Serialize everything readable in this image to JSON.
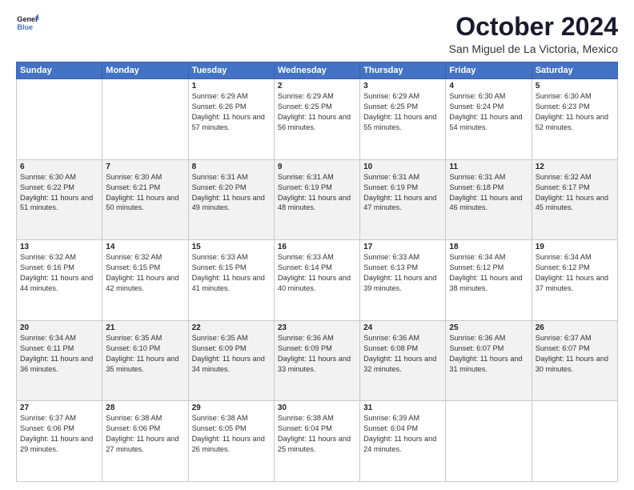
{
  "header": {
    "logo_line1": "General",
    "logo_line2": "Blue",
    "month": "October 2024",
    "location": "San Miguel de La Victoria, Mexico"
  },
  "weekdays": [
    "Sunday",
    "Monday",
    "Tuesday",
    "Wednesday",
    "Thursday",
    "Friday",
    "Saturday"
  ],
  "weeks": [
    [
      {
        "day": "",
        "info": ""
      },
      {
        "day": "",
        "info": ""
      },
      {
        "day": "1",
        "info": "Sunrise: 6:29 AM\nSunset: 6:26 PM\nDaylight: 11 hours and 57 minutes."
      },
      {
        "day": "2",
        "info": "Sunrise: 6:29 AM\nSunset: 6:25 PM\nDaylight: 11 hours and 56 minutes."
      },
      {
        "day": "3",
        "info": "Sunrise: 6:29 AM\nSunset: 6:25 PM\nDaylight: 11 hours and 55 minutes."
      },
      {
        "day": "4",
        "info": "Sunrise: 6:30 AM\nSunset: 6:24 PM\nDaylight: 11 hours and 54 minutes."
      },
      {
        "day": "5",
        "info": "Sunrise: 6:30 AM\nSunset: 6:23 PM\nDaylight: 11 hours and 52 minutes."
      }
    ],
    [
      {
        "day": "6",
        "info": "Sunrise: 6:30 AM\nSunset: 6:22 PM\nDaylight: 11 hours and 51 minutes."
      },
      {
        "day": "7",
        "info": "Sunrise: 6:30 AM\nSunset: 6:21 PM\nDaylight: 11 hours and 50 minutes."
      },
      {
        "day": "8",
        "info": "Sunrise: 6:31 AM\nSunset: 6:20 PM\nDaylight: 11 hours and 49 minutes."
      },
      {
        "day": "9",
        "info": "Sunrise: 6:31 AM\nSunset: 6:19 PM\nDaylight: 11 hours and 48 minutes."
      },
      {
        "day": "10",
        "info": "Sunrise: 6:31 AM\nSunset: 6:19 PM\nDaylight: 11 hours and 47 minutes."
      },
      {
        "day": "11",
        "info": "Sunrise: 6:31 AM\nSunset: 6:18 PM\nDaylight: 11 hours and 46 minutes."
      },
      {
        "day": "12",
        "info": "Sunrise: 6:32 AM\nSunset: 6:17 PM\nDaylight: 11 hours and 45 minutes."
      }
    ],
    [
      {
        "day": "13",
        "info": "Sunrise: 6:32 AM\nSunset: 6:16 PM\nDaylight: 11 hours and 44 minutes."
      },
      {
        "day": "14",
        "info": "Sunrise: 6:32 AM\nSunset: 6:15 PM\nDaylight: 11 hours and 42 minutes."
      },
      {
        "day": "15",
        "info": "Sunrise: 6:33 AM\nSunset: 6:15 PM\nDaylight: 11 hours and 41 minutes."
      },
      {
        "day": "16",
        "info": "Sunrise: 6:33 AM\nSunset: 6:14 PM\nDaylight: 11 hours and 40 minutes."
      },
      {
        "day": "17",
        "info": "Sunrise: 6:33 AM\nSunset: 6:13 PM\nDaylight: 11 hours and 39 minutes."
      },
      {
        "day": "18",
        "info": "Sunrise: 6:34 AM\nSunset: 6:12 PM\nDaylight: 11 hours and 38 minutes."
      },
      {
        "day": "19",
        "info": "Sunrise: 6:34 AM\nSunset: 6:12 PM\nDaylight: 11 hours and 37 minutes."
      }
    ],
    [
      {
        "day": "20",
        "info": "Sunrise: 6:34 AM\nSunset: 6:11 PM\nDaylight: 11 hours and 36 minutes."
      },
      {
        "day": "21",
        "info": "Sunrise: 6:35 AM\nSunset: 6:10 PM\nDaylight: 11 hours and 35 minutes."
      },
      {
        "day": "22",
        "info": "Sunrise: 6:35 AM\nSunset: 6:09 PM\nDaylight: 11 hours and 34 minutes."
      },
      {
        "day": "23",
        "info": "Sunrise: 6:36 AM\nSunset: 6:09 PM\nDaylight: 11 hours and 33 minutes."
      },
      {
        "day": "24",
        "info": "Sunrise: 6:36 AM\nSunset: 6:08 PM\nDaylight: 11 hours and 32 minutes."
      },
      {
        "day": "25",
        "info": "Sunrise: 6:36 AM\nSunset: 6:07 PM\nDaylight: 11 hours and 31 minutes."
      },
      {
        "day": "26",
        "info": "Sunrise: 6:37 AM\nSunset: 6:07 PM\nDaylight: 11 hours and 30 minutes."
      }
    ],
    [
      {
        "day": "27",
        "info": "Sunrise: 6:37 AM\nSunset: 6:06 PM\nDaylight: 11 hours and 29 minutes."
      },
      {
        "day": "28",
        "info": "Sunrise: 6:38 AM\nSunset: 6:06 PM\nDaylight: 11 hours and 27 minutes."
      },
      {
        "day": "29",
        "info": "Sunrise: 6:38 AM\nSunset: 6:05 PM\nDaylight: 11 hours and 26 minutes."
      },
      {
        "day": "30",
        "info": "Sunrise: 6:38 AM\nSunset: 6:04 PM\nDaylight: 11 hours and 25 minutes."
      },
      {
        "day": "31",
        "info": "Sunrise: 6:39 AM\nSunset: 6:04 PM\nDaylight: 11 hours and 24 minutes."
      },
      {
        "day": "",
        "info": ""
      },
      {
        "day": "",
        "info": ""
      }
    ]
  ]
}
